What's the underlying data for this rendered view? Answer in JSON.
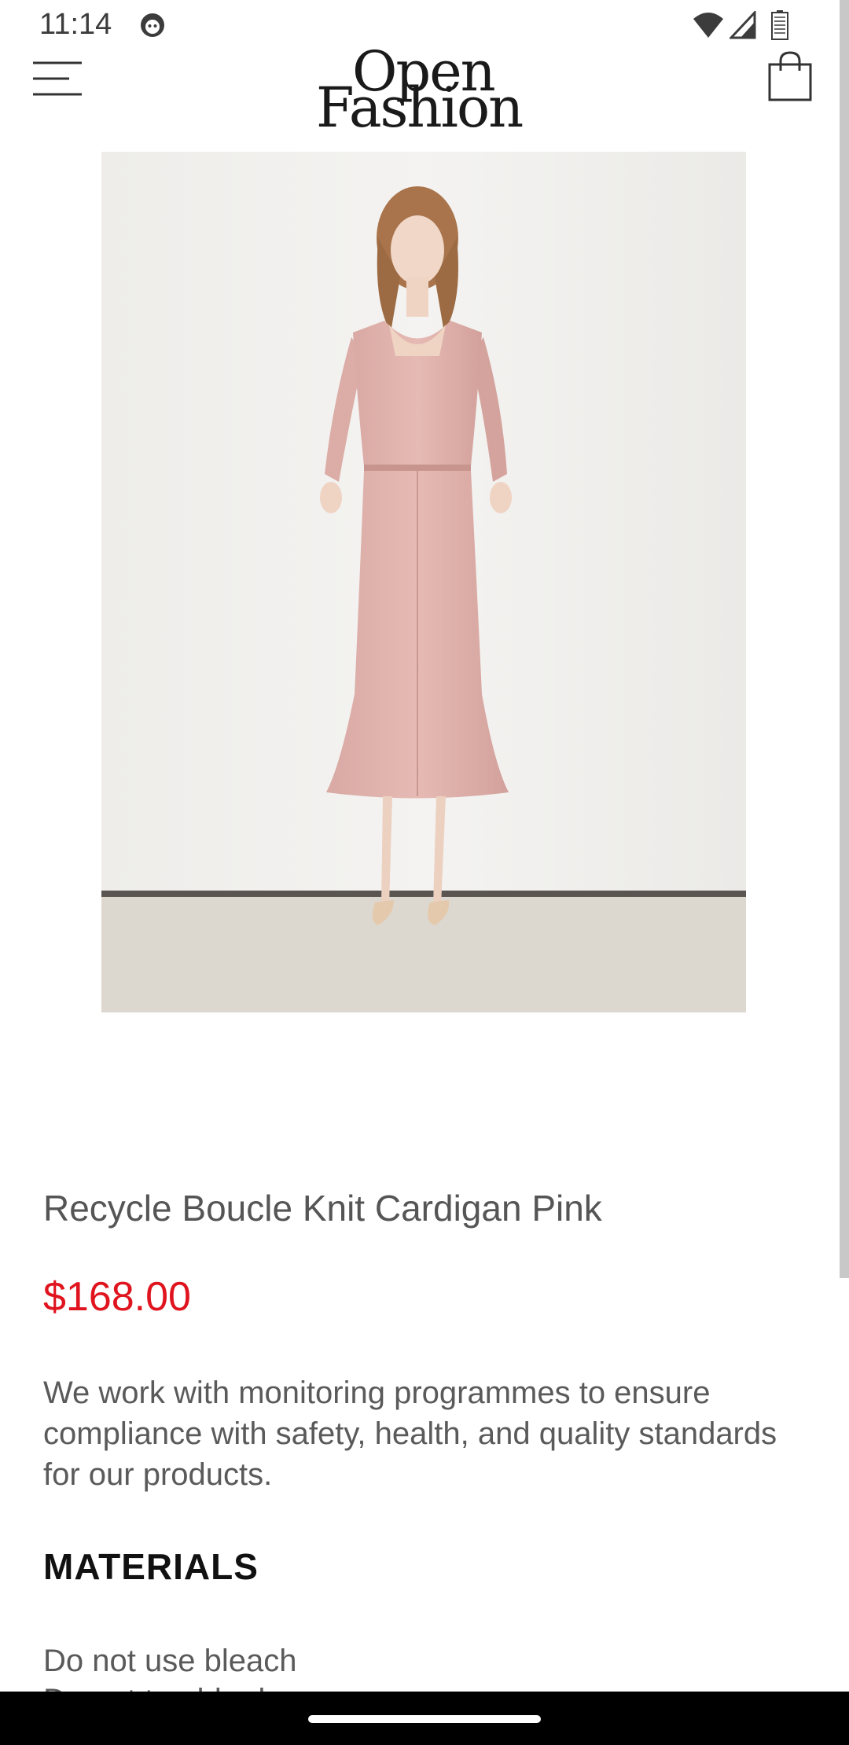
{
  "status_bar": {
    "time": "11:14",
    "icons": [
      "app-notification-icon",
      "wifi-icon",
      "cellular-signal-icon",
      "battery-icon"
    ]
  },
  "header": {
    "logo_line1": "Open",
    "logo_line2": "Fashion",
    "menu_icon": "hamburger-menu-icon",
    "cart_icon": "shopping-bag-icon"
  },
  "product": {
    "image": "pink-midi-dress-photo",
    "title": "Recycle Boucle Knit Cardigan Pink",
    "price": "$168.00",
    "description": "We work with monitoring programmes to ensure compliance with safety, health, and quality standards for our products.",
    "materials_heading": "MATERIALS",
    "care_items": [
      "Do not use bleach",
      "Do not tumble dry"
    ]
  },
  "colors": {
    "price": "#e0141e",
    "text": "#555555",
    "heading": "#111111",
    "background": "#ffffff",
    "nav_bar": "#000000"
  }
}
